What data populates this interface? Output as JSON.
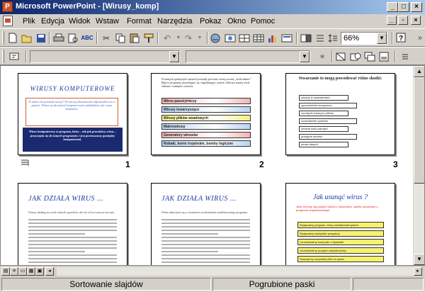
{
  "window": {
    "app_icon": "P",
    "title": "Microsoft PowerPoint - [Wirusy_komp]",
    "minimize": "_",
    "maximize": "□",
    "close": "×"
  },
  "menu": [
    "Plik",
    "Edycja",
    "Widok",
    "Wstaw",
    "Format",
    "Narzędzia",
    "Pokaz",
    "Okno",
    "Pomoc"
  ],
  "toolbar": {
    "zoom": "66%",
    "help_icon": "?"
  },
  "slides": [
    {
      "number": "1",
      "title": "WIRUSY KOMPUTEROWE",
      "body": "W jakim celu powstały wirusy? Nie da się jednoznacznie odpowiedzieć na to pytanie. Wirusy są tak starymi komputerowymi szkodnikami, jak i same komputery.",
      "box": "Wirus komputerowy to program, który – tak jak prawdziwy wirus – przyczepia się do innych programów i jest przenoszony pomiędzy komputerami."
    },
    {
      "number": "2",
      "intro": "W tamtych spokojnych czasach powstały pierwsze wirusy zwane „króliczkami”. Były to programy powielające się i zapełniające system. Obecnie znamy wiele odmian i rodzajów wirusów.",
      "bars": [
        {
          "label": "Wirus pasożytniczy",
          "color": "#f4b4b4"
        },
        {
          "label": "Wirusy towarzyszące",
          "color": "#b8d4f4"
        },
        {
          "label": "Wirusy plików wsadowych",
          "color": "#f4f080"
        },
        {
          "label": "Makrowirusy",
          "color": "#b8d4f4"
        },
        {
          "label": "Generatory wirusów",
          "color": "#f4b4b4"
        },
        {
          "label": "Robaki, konie trojańskie, bomby logiczne",
          "color": "#b8d4f4"
        }
      ]
    },
    {
      "number": "3",
      "title": "Stwarzanie to mogą powodować różne skutki:",
      "items": [
        "zmiany w ustawieniach",
        "spowolnienie komputera",
        "usunięcie ważnych plików",
        "uszkodzenie systemu",
        "zmiana kodu pamięci",
        "przejęcie kontroli",
        "utrata danych"
      ]
    },
    {
      "number": "4",
      "title": "JAK DZIAŁA WIRUS ...",
      "text": "Wirusy działają na wiele różnych sposobów, ale ich cel jest zawsze ten sam."
    },
    {
      "number": "5",
      "title": "JAK DZIAŁA WIRUS ...",
      "text": "Wirus uaktywnia się w momencie uruchomienia zainfekowanego programu."
    },
    {
      "number": "6",
      "title": "Jak usunąć wirus ?",
      "intro": "Jeśli chcemy się pozbyć wirusa z komputera, należy skorzystać z programu antywirusowego.",
      "items": [
        "Wyłączamy program, który zainfekował system",
        "Wyłączamy wszystkie programy",
        "Uruchamiamy komputer z dyskietki",
        "Uruchamiamy program antywirusowy",
        "Skanujemy wszystkie pliki na dysku"
      ]
    }
  ],
  "status": {
    "left": "Sortowanie slajdów",
    "right": "Pogrubione paski"
  }
}
